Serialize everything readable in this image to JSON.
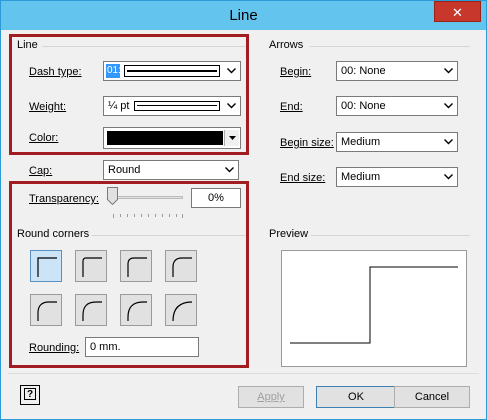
{
  "window": {
    "title": "Line",
    "close_glyph": "✕"
  },
  "line_group": {
    "title": "Line",
    "dash_type_label": "Dash type:",
    "dash_type_value": "01:",
    "weight_label": "Weight:",
    "weight_value": "¼ pt",
    "color_label": "Color:",
    "color_value": "#000000",
    "cap_label": "Cap:",
    "cap_value": "Round",
    "transparency_label": "Transparency:",
    "transparency_value": "0%",
    "transparency_level": 0
  },
  "round_corners": {
    "title": "Round corners",
    "selected_index": 0,
    "rounding_label": "Rounding:",
    "rounding_value": "0 mm."
  },
  "arrows_group": {
    "title": "Arrows",
    "begin_label": "Begin:",
    "begin_value": "00: None",
    "end_label": "End:",
    "end_value": "00: None",
    "begin_size_label": "Begin size:",
    "begin_size_value": "Medium",
    "end_size_label": "End size:",
    "end_size_value": "Medium"
  },
  "preview": {
    "title": "Preview"
  },
  "footer": {
    "help_glyph": "?",
    "apply_label": "Apply",
    "ok_label": "OK",
    "cancel_label": "Cancel"
  },
  "colors": {
    "highlight_box": "#a11d21",
    "title_bar": "#63c5ee",
    "close": "#c7372b"
  }
}
